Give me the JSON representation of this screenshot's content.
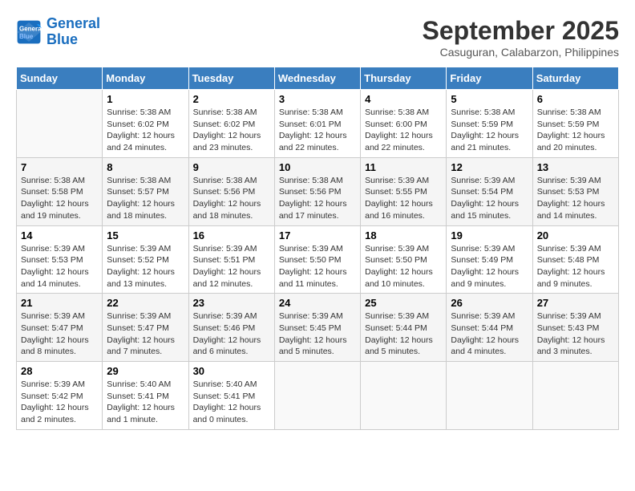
{
  "header": {
    "logo_line1": "General",
    "logo_line2": "Blue",
    "month_title": "September 2025",
    "subtitle": "Casuguran, Calabarzon, Philippines"
  },
  "days_of_week": [
    "Sunday",
    "Monday",
    "Tuesday",
    "Wednesday",
    "Thursday",
    "Friday",
    "Saturday"
  ],
  "weeks": [
    [
      {
        "day": "",
        "info": ""
      },
      {
        "day": "1",
        "info": "Sunrise: 5:38 AM\nSunset: 6:02 PM\nDaylight: 12 hours\nand 24 minutes."
      },
      {
        "day": "2",
        "info": "Sunrise: 5:38 AM\nSunset: 6:02 PM\nDaylight: 12 hours\nand 23 minutes."
      },
      {
        "day": "3",
        "info": "Sunrise: 5:38 AM\nSunset: 6:01 PM\nDaylight: 12 hours\nand 22 minutes."
      },
      {
        "day": "4",
        "info": "Sunrise: 5:38 AM\nSunset: 6:00 PM\nDaylight: 12 hours\nand 22 minutes."
      },
      {
        "day": "5",
        "info": "Sunrise: 5:38 AM\nSunset: 5:59 PM\nDaylight: 12 hours\nand 21 minutes."
      },
      {
        "day": "6",
        "info": "Sunrise: 5:38 AM\nSunset: 5:59 PM\nDaylight: 12 hours\nand 20 minutes."
      }
    ],
    [
      {
        "day": "7",
        "info": "Sunrise: 5:38 AM\nSunset: 5:58 PM\nDaylight: 12 hours\nand 19 minutes."
      },
      {
        "day": "8",
        "info": "Sunrise: 5:38 AM\nSunset: 5:57 PM\nDaylight: 12 hours\nand 18 minutes."
      },
      {
        "day": "9",
        "info": "Sunrise: 5:38 AM\nSunset: 5:56 PM\nDaylight: 12 hours\nand 18 minutes."
      },
      {
        "day": "10",
        "info": "Sunrise: 5:38 AM\nSunset: 5:56 PM\nDaylight: 12 hours\nand 17 minutes."
      },
      {
        "day": "11",
        "info": "Sunrise: 5:39 AM\nSunset: 5:55 PM\nDaylight: 12 hours\nand 16 minutes."
      },
      {
        "day": "12",
        "info": "Sunrise: 5:39 AM\nSunset: 5:54 PM\nDaylight: 12 hours\nand 15 minutes."
      },
      {
        "day": "13",
        "info": "Sunrise: 5:39 AM\nSunset: 5:53 PM\nDaylight: 12 hours\nand 14 minutes."
      }
    ],
    [
      {
        "day": "14",
        "info": "Sunrise: 5:39 AM\nSunset: 5:53 PM\nDaylight: 12 hours\nand 14 minutes."
      },
      {
        "day": "15",
        "info": "Sunrise: 5:39 AM\nSunset: 5:52 PM\nDaylight: 12 hours\nand 13 minutes."
      },
      {
        "day": "16",
        "info": "Sunrise: 5:39 AM\nSunset: 5:51 PM\nDaylight: 12 hours\nand 12 minutes."
      },
      {
        "day": "17",
        "info": "Sunrise: 5:39 AM\nSunset: 5:50 PM\nDaylight: 12 hours\nand 11 minutes."
      },
      {
        "day": "18",
        "info": "Sunrise: 5:39 AM\nSunset: 5:50 PM\nDaylight: 12 hours\nand 10 minutes."
      },
      {
        "day": "19",
        "info": "Sunrise: 5:39 AM\nSunset: 5:49 PM\nDaylight: 12 hours\nand 9 minutes."
      },
      {
        "day": "20",
        "info": "Sunrise: 5:39 AM\nSunset: 5:48 PM\nDaylight: 12 hours\nand 9 minutes."
      }
    ],
    [
      {
        "day": "21",
        "info": "Sunrise: 5:39 AM\nSunset: 5:47 PM\nDaylight: 12 hours\nand 8 minutes."
      },
      {
        "day": "22",
        "info": "Sunrise: 5:39 AM\nSunset: 5:47 PM\nDaylight: 12 hours\nand 7 minutes."
      },
      {
        "day": "23",
        "info": "Sunrise: 5:39 AM\nSunset: 5:46 PM\nDaylight: 12 hours\nand 6 minutes."
      },
      {
        "day": "24",
        "info": "Sunrise: 5:39 AM\nSunset: 5:45 PM\nDaylight: 12 hours\nand 5 minutes."
      },
      {
        "day": "25",
        "info": "Sunrise: 5:39 AM\nSunset: 5:44 PM\nDaylight: 12 hours\nand 5 minutes."
      },
      {
        "day": "26",
        "info": "Sunrise: 5:39 AM\nSunset: 5:44 PM\nDaylight: 12 hours\nand 4 minutes."
      },
      {
        "day": "27",
        "info": "Sunrise: 5:39 AM\nSunset: 5:43 PM\nDaylight: 12 hours\nand 3 minutes."
      }
    ],
    [
      {
        "day": "28",
        "info": "Sunrise: 5:39 AM\nSunset: 5:42 PM\nDaylight: 12 hours\nand 2 minutes."
      },
      {
        "day": "29",
        "info": "Sunrise: 5:40 AM\nSunset: 5:41 PM\nDaylight: 12 hours\nand 1 minute."
      },
      {
        "day": "30",
        "info": "Sunrise: 5:40 AM\nSunset: 5:41 PM\nDaylight: 12 hours\nand 0 minutes."
      },
      {
        "day": "",
        "info": ""
      },
      {
        "day": "",
        "info": ""
      },
      {
        "day": "",
        "info": ""
      },
      {
        "day": "",
        "info": ""
      }
    ]
  ]
}
